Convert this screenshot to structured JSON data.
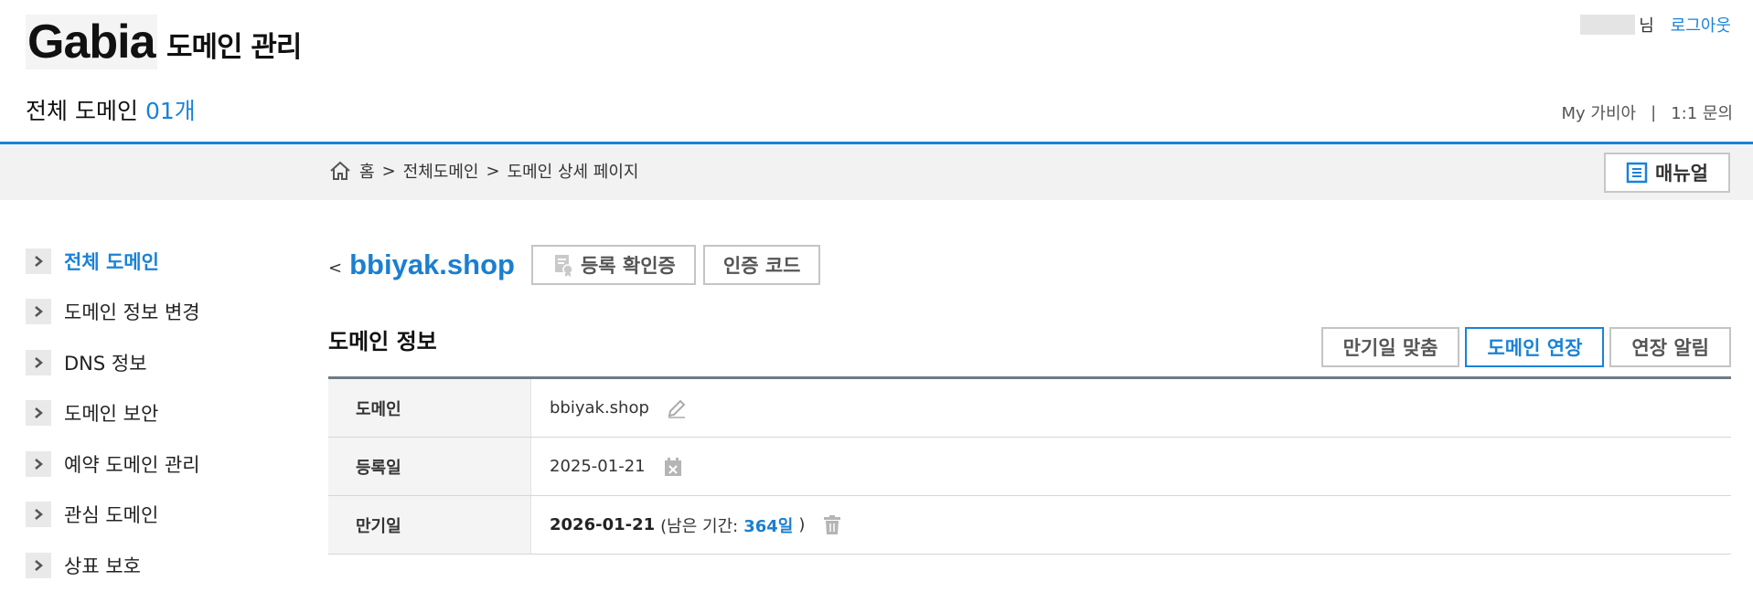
{
  "header": {
    "logo_text": "Gabia",
    "service_title": "도메인 관리",
    "domain_count_label": "전체 도메인",
    "domain_count_value": "01개",
    "user_suffix": "님",
    "logout_label": "로그아웃",
    "links": [
      "My 가비아",
      "|",
      "1:1 문의"
    ]
  },
  "breadcrumb": {
    "items": [
      "홈",
      ">",
      "전체도메인",
      ">",
      "도메인 상세 페이지"
    ],
    "manual_label": "매뉴얼"
  },
  "sidebar": {
    "items": [
      {
        "label": "전체 도메인",
        "active": true
      },
      {
        "label": "도메인 정보 변경",
        "active": false
      },
      {
        "label": "DNS 정보",
        "active": false
      },
      {
        "label": "도메인 보안",
        "active": false
      },
      {
        "label": "예약 도메인 관리",
        "active": false
      },
      {
        "label": "관심 도메인",
        "active": false
      },
      {
        "label": "상표 보호",
        "active": false
      }
    ]
  },
  "main": {
    "back_arrow": "<",
    "domain_name": "bbiyak.shop",
    "cert_button": "등록 확인증",
    "auth_code_button": "인증 코드",
    "section_title": "도메인 정보",
    "actions": [
      "만기일 맞춤",
      "도메인 연장",
      "연장 알림"
    ],
    "table": {
      "domain_label": "도메인",
      "domain_value": "bbiyak.shop",
      "reg_label": "등록일",
      "reg_value": "2025-01-21",
      "exp_label": "만기일",
      "exp_date": "2026-01-21",
      "remain_prefix": "(남은 기간:",
      "remain_value": "364일",
      "remain_suffix": ")"
    }
  },
  "colors": {
    "accent": "#1a82d8",
    "header_border": "#1a82d8",
    "crumb_bg": "#f2f2f2"
  },
  "icons": {
    "home": "home-icon",
    "manual": "document-list-icon",
    "cert": "certificate-icon",
    "edit": "pencil-icon",
    "calendar": "calendar-icon",
    "trash": "trash-icon",
    "chevron": "chevron-right-icon"
  }
}
